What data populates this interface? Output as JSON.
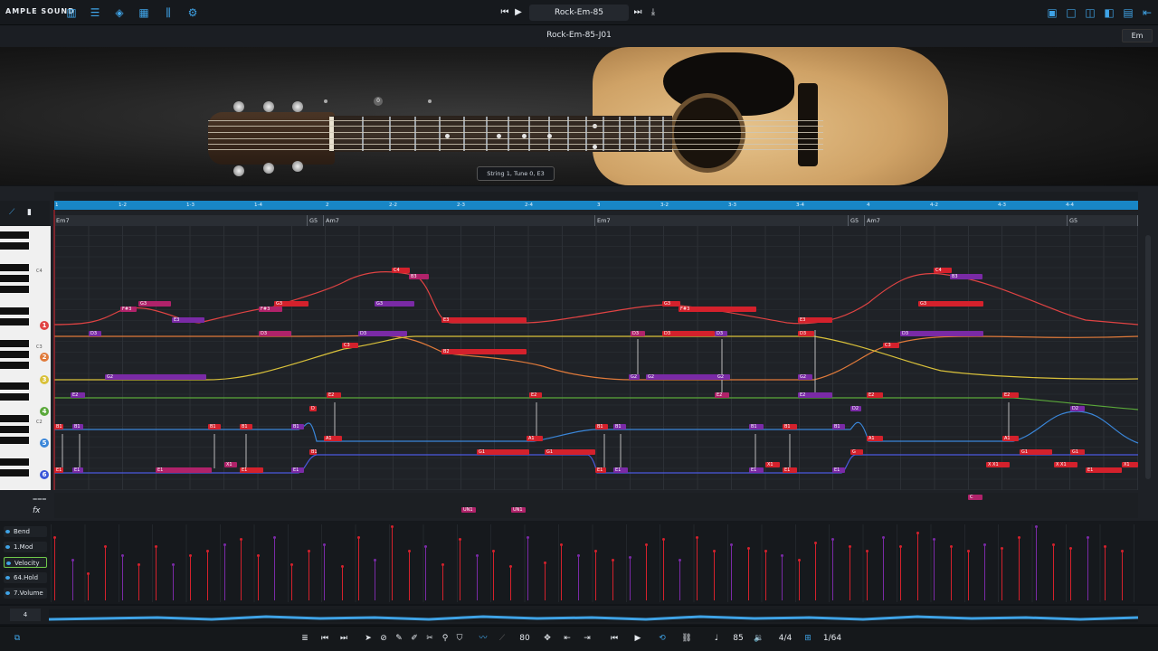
{
  "app": {
    "logo": "AMPLE SOUND"
  },
  "topbar": {
    "left_icons": [
      "piano-icon",
      "sliders-icon",
      "shield-icon",
      "grid-icon",
      "mixer-icon",
      "gear-icon"
    ],
    "preset": "Rock-Em-85",
    "right_icons": [
      "layout-1-icon",
      "layout-2-icon",
      "layout-3-icon",
      "layout-4-icon",
      "window-icon",
      "collapse-icon"
    ]
  },
  "subbar": {
    "title": "Rock-Em-85-J01",
    "key": "Em"
  },
  "guitar": {
    "tooltip": "String 1, Tune 0, E3",
    "capo_marker": "0"
  },
  "ruler": {
    "ticks": [
      "1",
      "1-2",
      "1-3",
      "1-4",
      "2",
      "2-2",
      "2-3",
      "2-4",
      "3",
      "3-2",
      "3-3",
      "3-4",
      "4",
      "4-2",
      "4-3",
      "4-4"
    ]
  },
  "chords": [
    {
      "name": "Em7"
    },
    {
      "name": "G5"
    },
    {
      "name": "Am7"
    },
    {
      "name": "Em7"
    },
    {
      "name": "G5"
    },
    {
      "name": "Am7"
    },
    {
      "name": "G5"
    }
  ],
  "piano": {
    "c4": "C4",
    "c3": "C3",
    "c2": "C2"
  },
  "strings": [
    "1",
    "2",
    "3",
    "4",
    "5",
    "6"
  ],
  "string_colors": [
    "#e04343",
    "#e07a3a",
    "#d9c13a",
    "#5aa83a",
    "#3a86d9",
    "#3a56d9"
  ],
  "notes": [
    {
      "label": "E1",
      "cls": "red"
    },
    {
      "label": "E1",
      "cls": "pur"
    },
    {
      "label": "B1",
      "cls": "red"
    },
    {
      "label": "B1",
      "cls": "pur"
    },
    {
      "label": "D3",
      "cls": "pur"
    },
    {
      "label": "F#3",
      "cls": "mag"
    },
    {
      "label": "G3",
      "cls": "mag"
    },
    {
      "label": "E3",
      "cls": "pur"
    },
    {
      "label": "G2",
      "cls": "pur"
    },
    {
      "label": "E2",
      "cls": "pur"
    },
    {
      "label": "E1",
      "cls": "mag"
    },
    {
      "label": "B1",
      "cls": "red"
    },
    {
      "label": "X1",
      "cls": "mag"
    },
    {
      "label": "E1",
      "cls": "red"
    },
    {
      "label": "B1",
      "cls": "red"
    },
    {
      "label": "F#3",
      "cls": "mag"
    },
    {
      "label": "G3",
      "cls": "red"
    },
    {
      "label": "D3",
      "cls": "mag"
    },
    {
      "label": "E1",
      "cls": "pur"
    },
    {
      "label": "B1",
      "cls": "pur"
    },
    {
      "label": "D",
      "cls": "red"
    },
    {
      "label": "E2",
      "cls": "red"
    },
    {
      "label": "A1",
      "cls": "red"
    },
    {
      "label": "B1",
      "cls": "red"
    },
    {
      "label": "C3",
      "cls": "red"
    },
    {
      "label": "G3",
      "cls": "pur"
    },
    {
      "label": "D3",
      "cls": "pur"
    },
    {
      "label": "C4",
      "cls": "red"
    },
    {
      "label": "B3",
      "cls": "mag"
    },
    {
      "label": "E3",
      "cls": "red"
    },
    {
      "label": "B2",
      "cls": "red"
    },
    {
      "label": "G1",
      "cls": "red"
    },
    {
      "label": "E2",
      "cls": "red"
    },
    {
      "label": "A1",
      "cls": "red"
    },
    {
      "label": "G1",
      "cls": "red"
    },
    {
      "label": "E1",
      "cls": "red"
    },
    {
      "label": "B1",
      "cls": "red"
    },
    {
      "label": "B1",
      "cls": "pur"
    },
    {
      "label": "E1",
      "cls": "pur"
    },
    {
      "label": "G2",
      "cls": "pur"
    },
    {
      "label": "G2",
      "cls": "pur"
    },
    {
      "label": "D3",
      "cls": "mag"
    },
    {
      "label": "D3",
      "cls": "red"
    },
    {
      "label": "D3",
      "cls": "pur"
    },
    {
      "label": "G3",
      "cls": "red"
    },
    {
      "label": "F#3",
      "cls": "red"
    },
    {
      "label": "G2",
      "cls": "pur"
    },
    {
      "label": "E2",
      "cls": "mag"
    },
    {
      "label": "B1",
      "cls": "pur"
    },
    {
      "label": "E1",
      "cls": "pur"
    },
    {
      "label": "X1",
      "cls": "red"
    },
    {
      "label": "B1",
      "cls": "red"
    },
    {
      "label": "E1",
      "cls": "red"
    },
    {
      "label": "G2",
      "cls": "pur"
    },
    {
      "label": "E2",
      "cls": "pur"
    },
    {
      "label": "D3",
      "cls": "red"
    },
    {
      "label": "E3",
      "cls": "red"
    },
    {
      "label": "B1",
      "cls": "pur"
    },
    {
      "label": "E1",
      "cls": "pur"
    },
    {
      "label": "D2",
      "cls": "pur"
    },
    {
      "label": "G",
      "cls": "red"
    },
    {
      "label": "A1",
      "cls": "red"
    },
    {
      "label": "E2",
      "cls": "red"
    },
    {
      "label": "C3",
      "cls": "red"
    },
    {
      "label": "D3",
      "cls": "pur"
    },
    {
      "label": "G3",
      "cls": "red"
    },
    {
      "label": "C4",
      "cls": "red"
    },
    {
      "label": "B3",
      "cls": "pur"
    },
    {
      "label": "E2",
      "cls": "red"
    },
    {
      "label": "A1",
      "cls": "red"
    },
    {
      "label": "G1",
      "cls": "red"
    },
    {
      "label": "X X1",
      "cls": "red"
    },
    {
      "label": "D2",
      "cls": "pur"
    },
    {
      "label": "G1",
      "cls": "red"
    },
    {
      "label": "X X1",
      "cls": "red"
    },
    {
      "label": "E1",
      "cls": "red"
    },
    {
      "label": "X1",
      "cls": "red"
    }
  ],
  "fx": {
    "un1a": "UN1",
    "un1b": "UN1",
    "mark": "C"
  },
  "lanes": [
    {
      "label": "Bend"
    },
    {
      "label": "1.Mod"
    },
    {
      "label": "Velocity"
    },
    {
      "label": "64.Hold"
    },
    {
      "label": "7.Volume"
    }
  ],
  "overview": {
    "box": "4"
  },
  "bottom": {
    "icons": [
      "link-icon",
      "list-icon",
      "prev-icon",
      "next-icon",
      "pointer-icon",
      "erase-icon",
      "pencil-icon",
      "brush-icon",
      "cut-icon",
      "pin-icon",
      "guard-icon",
      "wave-icon",
      "line-icon"
    ],
    "quantize": "80",
    "transport_icons": [
      "rewind-icon",
      "play-icon",
      "loop-icon",
      "chain-icon",
      "metronome-icon"
    ],
    "tempo": "85",
    "signature": "4/4",
    "snap": "1/64"
  }
}
